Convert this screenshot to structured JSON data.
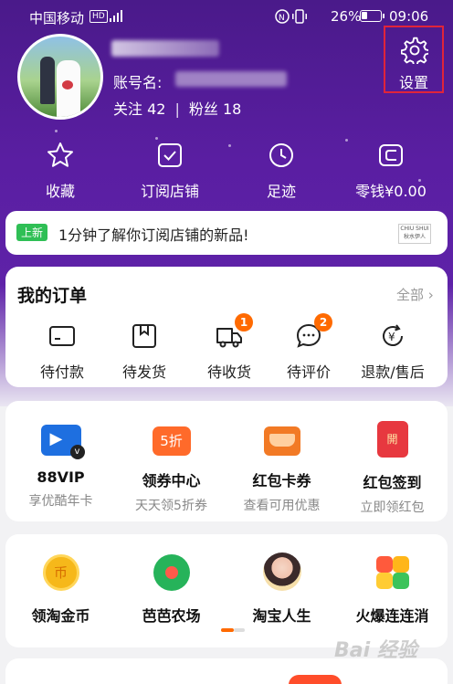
{
  "status_bar": {
    "carrier": "中国移动",
    "hd": "HD",
    "battery": "26%",
    "time": "09:06"
  },
  "profile": {
    "account_label": "账号名:",
    "following_label": "关注",
    "following_count": "42",
    "fans_label": "粉丝",
    "fans_count": "18",
    "settings_label": "设置"
  },
  "quick_links": [
    {
      "label": "收藏",
      "icon": "star-icon"
    },
    {
      "label": "订阅店铺",
      "icon": "check-box-icon"
    },
    {
      "label": "足迹",
      "icon": "clock-icon"
    },
    {
      "label": "零钱¥0.00",
      "icon": "wallet-icon"
    }
  ],
  "banner": {
    "tag": "上新",
    "message": "1分钟了解你订阅店铺的新品!",
    "logo_text": "CHIU SHUI 秋水伊人"
  },
  "orders": {
    "title": "我的订单",
    "all": "全部",
    "items": [
      {
        "label": "待付款",
        "badge": ""
      },
      {
        "label": "待发货",
        "badge": ""
      },
      {
        "label": "待收货",
        "badge": "1"
      },
      {
        "label": "待评价",
        "badge": "2"
      },
      {
        "label": "退款/售后",
        "badge": ""
      }
    ]
  },
  "services": [
    {
      "title": "88VIP",
      "subtitle": "享优酷年卡"
    },
    {
      "title": "领券中心",
      "subtitle": "天天领5折券",
      "icon_text": "5折"
    },
    {
      "title": "红包卡券",
      "subtitle": "查看可用优惠"
    },
    {
      "title": "红包签到",
      "subtitle": "立即领红包",
      "icon_text": "開"
    }
  ],
  "games": [
    {
      "title": "领淘金币",
      "icon_text": "币"
    },
    {
      "title": "芭芭农场"
    },
    {
      "title": "淘宝人生"
    },
    {
      "title": "火爆连连消"
    }
  ],
  "watermark": "Bai 经验"
}
